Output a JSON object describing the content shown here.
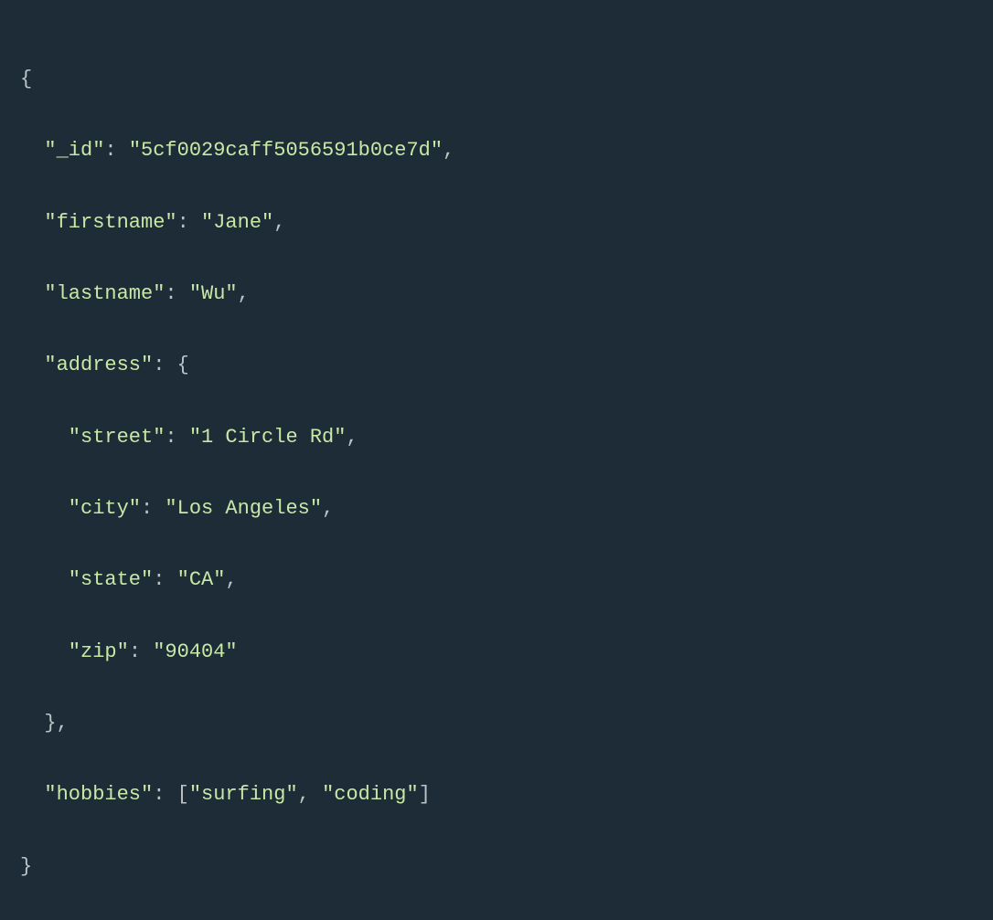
{
  "code": {
    "open_brace": "{",
    "close_brace": "}",
    "open_bracket": "[",
    "close_bracket": "]",
    "colon": ":",
    "comma": ",",
    "space": " ",
    "keys": {
      "id": "\"_id\"",
      "firstname": "\"firstname\"",
      "lastname": "\"lastname\"",
      "address": "\"address\"",
      "street": "\"street\"",
      "city": "\"city\"",
      "state": "\"state\"",
      "zip": "\"zip\"",
      "hobbies": "\"hobbies\""
    },
    "values": {
      "id": "\"5cf0029caff5056591b0ce7d\"",
      "firstname": "\"Jane\"",
      "lastname": "\"Wu\"",
      "street": "\"1 Circle Rd\"",
      "city": "\"Los Angeles\"",
      "state": "\"CA\"",
      "zip": "\"90404\"",
      "hobby1": "\"surfing\"",
      "hobby2": "\"coding\""
    }
  }
}
